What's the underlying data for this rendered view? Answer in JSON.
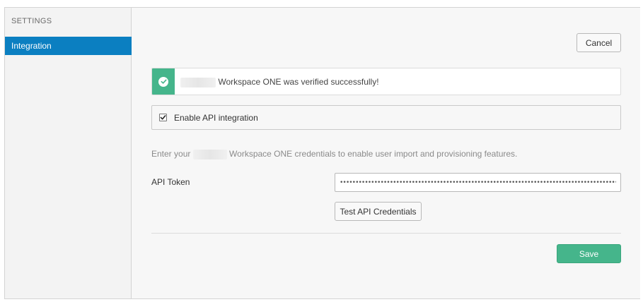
{
  "sidebar": {
    "heading": "SETTINGS",
    "items": [
      {
        "label": "Integration",
        "active": true
      }
    ]
  },
  "header": {
    "cancel_label": "Cancel"
  },
  "alert": {
    "status": "success",
    "icon": "check-circle-icon",
    "message": "Workspace ONE was verified successfully!",
    "color": "#45b58b"
  },
  "api_integration": {
    "label": "Enable API integration",
    "checked": true
  },
  "help_text": {
    "prefix": "Enter your",
    "suffix": "Workspace ONE credentials to enable user import and provisioning features."
  },
  "api_token": {
    "label": "API Token",
    "value": "••••••••••••••••••••••••••••••••••••••••••••••••••••••••••••••••••••••••••••••••••••••••••••••••••••"
  },
  "test_button": {
    "label": "Test API Credentials"
  },
  "save_button": {
    "label": "Save",
    "color": "#45b58b"
  },
  "colors": {
    "sidebar_active": "#0b7fc1",
    "success": "#45b58b"
  }
}
